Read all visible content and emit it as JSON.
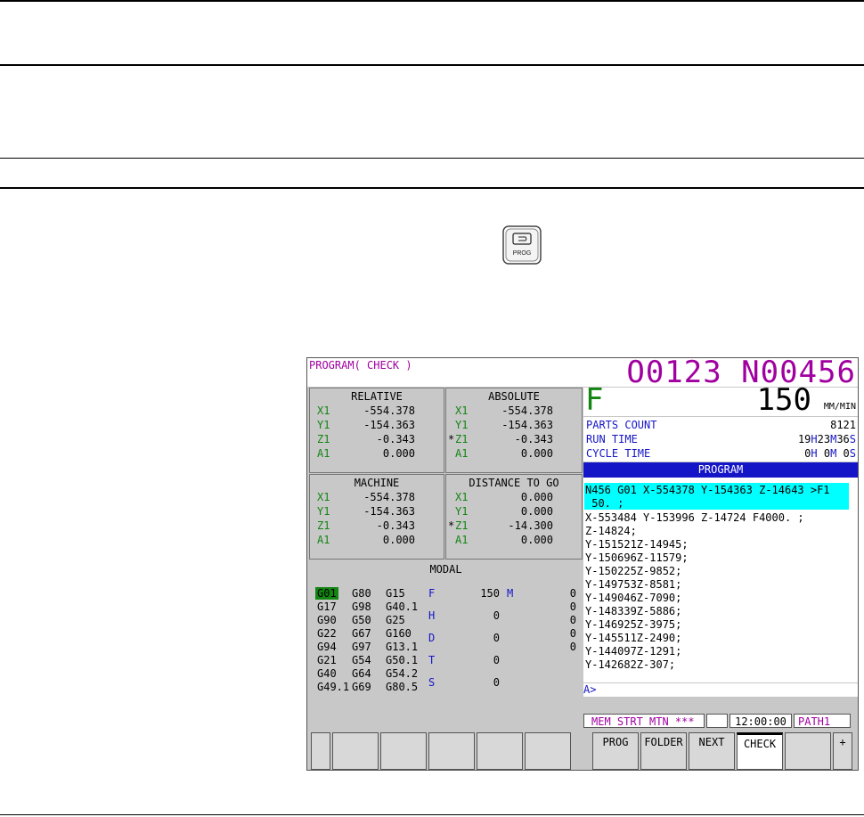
{
  "screen": {
    "title": "PROGRAM( CHECK )",
    "program_number": "O0123 N00456",
    "relative": {
      "title": "RELATIVE",
      "rows": [
        {
          "axis": "X1",
          "value": "-554.378",
          "star": ""
        },
        {
          "axis": "Y1",
          "value": "-154.363",
          "star": ""
        },
        {
          "axis": "Z1",
          "value": "-0.343",
          "star": ""
        },
        {
          "axis": "A1",
          "value": "0.000",
          "star": ""
        }
      ]
    },
    "absolute": {
      "title": "ABSOLUTE",
      "rows": [
        {
          "axis": "X1",
          "value": "-554.378",
          "star": ""
        },
        {
          "axis": "Y1",
          "value": "-154.363",
          "star": ""
        },
        {
          "axis": "Z1",
          "value": "-0.343",
          "star": "*"
        },
        {
          "axis": "A1",
          "value": "0.000",
          "star": ""
        }
      ]
    },
    "machine": {
      "title": "MACHINE",
      "rows": [
        {
          "axis": "X1",
          "value": "-554.378",
          "star": ""
        },
        {
          "axis": "Y1",
          "value": "-154.363",
          "star": ""
        },
        {
          "axis": "Z1",
          "value": "-0.343",
          "star": ""
        },
        {
          "axis": "A1",
          "value": "0.000",
          "star": ""
        }
      ]
    },
    "distance_to_go": {
      "title": "DISTANCE TO GO",
      "rows": [
        {
          "axis": "X1",
          "value": "0.000",
          "star": ""
        },
        {
          "axis": "Y1",
          "value": "0.000",
          "star": ""
        },
        {
          "axis": "Z1",
          "value": "-14.300",
          "star": "*"
        },
        {
          "axis": "A1",
          "value": "0.000",
          "star": ""
        }
      ]
    },
    "modal": {
      "title": "MODAL",
      "gcodes": [
        [
          "G01",
          "G80",
          "G15"
        ],
        [
          "G17",
          "G98",
          "G40.1"
        ],
        [
          "G90",
          "G50",
          "G25"
        ],
        [
          "G22",
          "G67",
          "G160"
        ],
        [
          "G94",
          "G97",
          "G13.1"
        ],
        [
          "G21",
          "G54",
          "G50.1"
        ],
        [
          "G40",
          "G64",
          "G54.2"
        ],
        [
          "G49.1",
          "G69",
          "G80.5"
        ]
      ],
      "f_label": "F",
      "f_value": "150",
      "h_label": "H",
      "h_value": "0",
      "d_label": "D",
      "d_value": "0",
      "t_label": "T",
      "t_value": "0",
      "s_label": "S",
      "s_value": "0",
      "m_label": "M",
      "m_values": [
        "0",
        "0",
        "0",
        "0",
        "0"
      ]
    },
    "feed": {
      "label": "F",
      "value": "150",
      "unit": "MM/MIN"
    },
    "parts_count": {
      "label": "PARTS COUNT",
      "value": "8121"
    },
    "run_time": {
      "label": "RUN TIME",
      "h": "19",
      "h_unit": "H",
      "m": "23",
      "m_unit": "M",
      "s": "36",
      "s_unit": "S"
    },
    "cycle_time": {
      "label": "CYCLE TIME",
      "h": "0",
      "h_unit": "H",
      "m": "0",
      "m_unit": "M",
      "s": "0",
      "s_unit": "S"
    },
    "program_header": "PROGRAM",
    "program_lines": [
      "N456 G01 X-554378 Y-154363 Z-14643 >F1",
      " 50. ;",
      "X-553484 Y-153996 Z-14724 F4000. ;",
      "Z-14824;",
      "Y-151521Z-14945;",
      "Y-150696Z-11579;",
      "Y-150225Z-9852;",
      "Y-149753Z-8581;",
      "Y-149046Z-7090;",
      "Y-148339Z-5886;",
      "Y-146925Z-3975;",
      "Y-145511Z-2490;",
      "Y-144097Z-1291;",
      "Y-142682Z-307;"
    ],
    "input_prompt": "A>",
    "status": {
      "mode": "MEM  STRT MTN ***",
      "time": "12:00:00",
      "path": "PATH1"
    },
    "softkeys": [
      "PROG",
      "FOLDER",
      "NEXT",
      "CHECK",
      "",
      "+"
    ]
  }
}
